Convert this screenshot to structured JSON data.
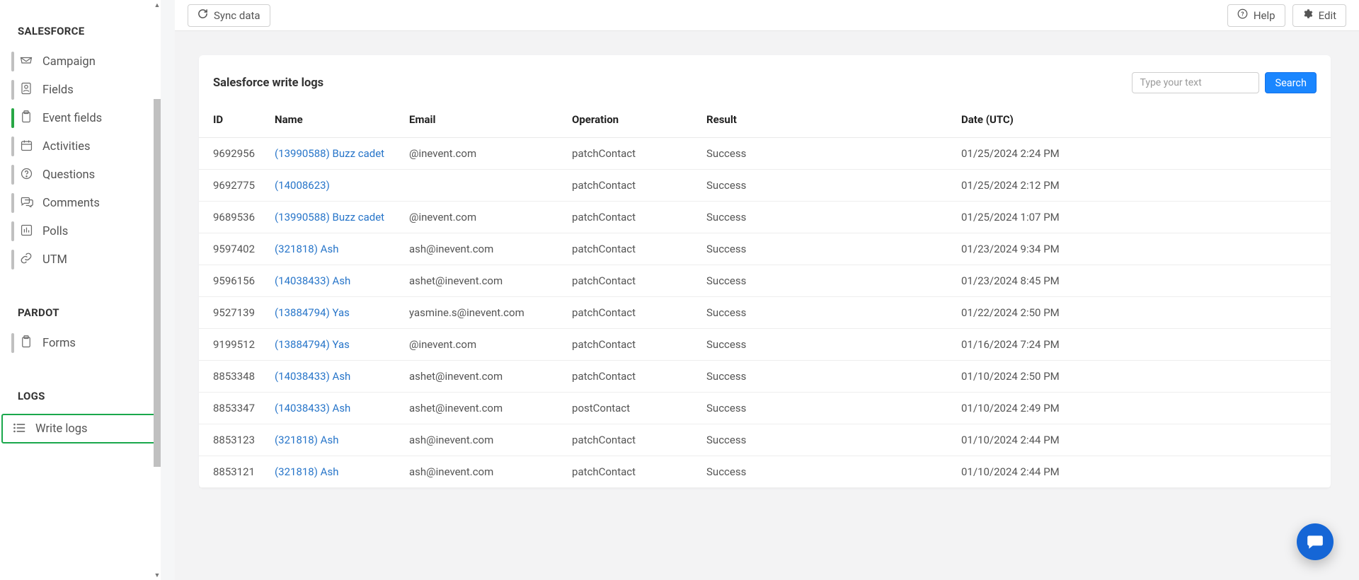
{
  "sidebar": {
    "sections": [
      {
        "label": "SALESFORCE",
        "items": [
          {
            "label": "Campaign",
            "icon": "inbox",
            "interact": true
          },
          {
            "label": "Fields",
            "icon": "id",
            "interact": true
          },
          {
            "label": "Event fields",
            "icon": "clipboard",
            "interact": true,
            "active": true
          },
          {
            "label": "Activities",
            "icon": "calendar",
            "interact": true
          },
          {
            "label": "Questions",
            "icon": "question",
            "interact": true
          },
          {
            "label": "Comments",
            "icon": "comments",
            "interact": true
          },
          {
            "label": "Polls",
            "icon": "chart",
            "interact": true
          },
          {
            "label": "UTM",
            "icon": "link",
            "interact": true
          }
        ]
      },
      {
        "label": "PARDOT",
        "items": [
          {
            "label": "Forms",
            "icon": "clipboard",
            "interact": true
          }
        ]
      },
      {
        "label": "LOGS",
        "items": [
          {
            "label": "Write logs",
            "icon": "list",
            "interact": true,
            "highlight": true
          }
        ]
      }
    ]
  },
  "topbar": {
    "sync_label": "Sync data",
    "help_label": "Help",
    "edit_label": "Edit"
  },
  "panel": {
    "title": "Salesforce write logs",
    "search_placeholder": "Type your text",
    "search_button": "Search",
    "columns": [
      "ID",
      "Name",
      "Email",
      "Operation",
      "Result",
      "Date (UTC)"
    ],
    "rows": [
      {
        "id": "9692956",
        "name": "(13990588) Buzz cadet",
        "email": "@inevent.com",
        "op": "patchContact",
        "res": "Success",
        "date": "01/25/2024 2:24 PM"
      },
      {
        "id": "9692775",
        "name": "(14008623)",
        "email": "",
        "op": "patchContact",
        "res": "Success",
        "date": "01/25/2024 2:12 PM"
      },
      {
        "id": "9689536",
        "name": "(13990588) Buzz cadet",
        "email": "@inevent.com",
        "op": "patchContact",
        "res": "Success",
        "date": "01/25/2024 1:07 PM"
      },
      {
        "id": "9597402",
        "name": "(321818) Ash",
        "email": "ash@inevent.com",
        "op": "patchContact",
        "res": "Success",
        "date": "01/23/2024 9:34 PM"
      },
      {
        "id": "9596156",
        "name": "(14038433) Ash",
        "email": "ashet@inevent.com",
        "op": "patchContact",
        "res": "Success",
        "date": "01/23/2024 8:45 PM"
      },
      {
        "id": "9527139",
        "name": "(13884794) Yas",
        "email": "yasmine.s@inevent.com",
        "op": "patchContact",
        "res": "Success",
        "date": "01/22/2024 2:50 PM"
      },
      {
        "id": "9199512",
        "name": "(13884794) Yas",
        "email": "@inevent.com",
        "op": "patchContact",
        "res": "Success",
        "date": "01/16/2024 7:24 PM"
      },
      {
        "id": "8853348",
        "name": "(14038433) Ash",
        "email": "ashet@inevent.com",
        "op": "patchContact",
        "res": "Success",
        "date": "01/10/2024 2:50 PM"
      },
      {
        "id": "8853347",
        "name": "(14038433) Ash",
        "email": "ashet@inevent.com",
        "op": "postContact",
        "res": "Success",
        "date": "01/10/2024 2:49 PM"
      },
      {
        "id": "8853123",
        "name": "(321818) Ash",
        "email": "ash@inevent.com",
        "op": "patchContact",
        "res": "Success",
        "date": "01/10/2024 2:44 PM"
      },
      {
        "id": "8853121",
        "name": "(321818) Ash",
        "email": "ash@inevent.com",
        "op": "patchContact",
        "res": "Success",
        "date": "01/10/2024 2:44 PM"
      }
    ]
  }
}
